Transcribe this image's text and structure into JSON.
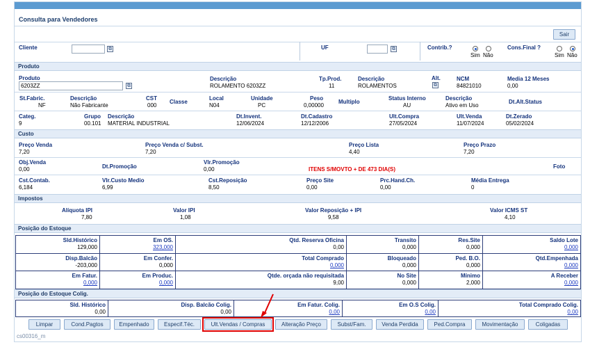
{
  "window": {
    "title": "Consulta para Vendedores",
    "footer_code": "cs00316_m"
  },
  "toolbar": {
    "exit_label": "Sair"
  },
  "header": {
    "cliente_label": "Cliente",
    "cliente_value": "",
    "uf_label": "UF",
    "uf_value": "",
    "contrib_label": "Contrib.?",
    "contrib_sim": "Sim",
    "contrib_nao": "Não",
    "contrib_selected": "Sim",
    "consfinal_label": "Cons.Final ?",
    "consfinal_sim": "Sim",
    "consfinal_nao": "Não",
    "consfinal_selected": "Não"
  },
  "produto": {
    "section": "Produto",
    "produto_label": "Produto",
    "produto_value": "6203ZZ",
    "descricao_label": "Descrição",
    "descricao_value": "ROLAMENTO 6203ZZ",
    "tpprod_label": "Tp.Prod.",
    "tpprod_value": "11",
    "descricao2_label": "Descrição",
    "descricao2_value": "ROLAMENTOS",
    "alt_label": "Alt.",
    "ncm_label": "NCM",
    "ncm_value": "84821010",
    "media12_label": "Media 12 Meses",
    "media12_value": "0,00",
    "stfabric_label": "St.Fabric.",
    "stfabric_value": "NF",
    "descricao3_label": "Descrição",
    "descricao3_value": "Não Fabricante",
    "cst_label": "CST",
    "cst_value": "000",
    "classe_label": "Classe",
    "local_label": "Local",
    "local_value": "N04",
    "unidade_label": "Unidade",
    "unidade_value": "PC",
    "peso_label": "Peso",
    "peso_value": "0,00000",
    "multiplo_label": "Multiplo",
    "statusint_label": "Status Interno",
    "statusint_value": "AU",
    "descricao4_label": "Descrição",
    "descricao4_value": "Ativo em Uso",
    "dtaltstatus_label": "Dt.Alt.Status",
    "categ_label": "Categ.",
    "categ_value": "9",
    "grupo_label": "Grupo",
    "grupo_value": "00.101",
    "descricao5_label": "Descrição",
    "descricao5_value": "MATERIAL INDUSTRIAL",
    "dtinvent_label": "Dt.Invent.",
    "dtinvent_value": "12/06/2024",
    "dtcadastro_label": "Dt.Cadastro",
    "dtcadastro_value": "12/12/2006",
    "ultcompra_label": "Ult.Compra",
    "ultcompra_value": "27/05/2024",
    "ultvenda_label": "Ult.Venda",
    "ultvenda_value": "11/07/2024",
    "dtzerado_label": "Dt.Zerado",
    "dtzerado_value": "05/02/2024"
  },
  "custo": {
    "section": "Custo",
    "precovenda_label": "Preço Venda",
    "precovenda_value": "7,20",
    "precovendasubst_label": "Preço Venda c/ Subst.",
    "precovendasubst_value": "7,20",
    "precolista_label": "Preço Lista",
    "precolista_value": "4,40",
    "precoprazo_label": "Preço Prazo",
    "precoprazo_value": "7,20",
    "objvenda_label": "Obj.Venda",
    "objvenda_value": "0,00",
    "dtpromocao_label": "Dt.Promoção",
    "vlrpromocao_label": "Vlr.Promoção",
    "vlrpromocao_value": "0,00",
    "alert": "ITENS S/MOVTO + DE 473 DIA(S)",
    "foto_label": "Foto",
    "cstcontab_label": "Cst.Contab.",
    "cstcontab_value": "6,184",
    "vlrcustomedio_label": "Vlr.Custo Medio",
    "vlrcustomedio_value": "6,99",
    "cstreposicao_label": "Cst.Reposição",
    "cstreposicao_value": "8,50",
    "precosite_label": "Preço Site",
    "precosite_value": "0,00",
    "prchandch_label": "Prc.Hand.Ch.",
    "prchandch_value": "0,00",
    "mediaentrega_label": "Média Entrega",
    "mediaentrega_value": "0"
  },
  "impostos": {
    "section": "Impostos",
    "aliquotaipi_label": "Alíquota IPI",
    "aliquotaipi_value": "7,80",
    "valoripi_label": "Valor IPI",
    "valoripi_value": "1,08",
    "valorreposicao_label": "Valor Reposição + IPI",
    "valorreposicao_value": "9,58",
    "valoricmsst_label": "Valor ICMS ST",
    "valoricmsst_value": "4,10"
  },
  "estoque": {
    "section": "Posição do Estoque",
    "rows": [
      [
        {
          "label": "Sld.Histórico",
          "value": "129,000",
          "link": false
        },
        {
          "label": "Em OS.",
          "value": "323,000",
          "link": true
        },
        {
          "label": "Qtd. Reserva Oficina",
          "value": "0,00",
          "link": false
        },
        {
          "label": "Transito",
          "value": "0,000",
          "link": false
        },
        {
          "label": "Res.Site",
          "value": "0,000",
          "link": false
        },
        {
          "label": "Saldo Lote",
          "value": "0,000",
          "link": true
        }
      ],
      [
        {
          "label": "Disp.Balcão",
          "value": "-203,000",
          "link": false
        },
        {
          "label": "Em Confer.",
          "value": "0,000",
          "link": false
        },
        {
          "label": "Total Comprado",
          "value": "0,000",
          "link": true
        },
        {
          "label": "Bloqueado",
          "value": "0,000",
          "link": false
        },
        {
          "label": "Ped. B.O.",
          "value": "0,000",
          "link": false
        },
        {
          "label": "Qtd.Empenhada",
          "value": "0,000",
          "link": true
        }
      ],
      [
        {
          "label": "Em Fatur.",
          "value": "0,000",
          "link": true
        },
        {
          "label": "Em Produc.",
          "value": "0,000",
          "link": true
        },
        {
          "label": "Qtde. orçada não requisitada",
          "value": "9,00",
          "link": false
        },
        {
          "label": "No Site",
          "value": "0,000",
          "link": false
        },
        {
          "label": "Mínimo",
          "value": "2,000",
          "link": false
        },
        {
          "label": "A Receber",
          "value": "0,000",
          "link": true
        }
      ]
    ]
  },
  "coligadas": {
    "section": "Posição do Estoque Colig.",
    "cells": [
      {
        "label": "Sld. Histórico",
        "value": "0,00",
        "link": false
      },
      {
        "label": "Disp. Balcão Colig.",
        "value": "0,00",
        "link": false
      },
      {
        "label": "Em Fatur. Colig.",
        "value": "0,00",
        "link": true
      },
      {
        "label": "Em O.S Colig.",
        "value": "0,00",
        "link": true
      },
      {
        "label": "Total Comprado Colig.",
        "value": "0,00",
        "link": true
      }
    ]
  },
  "actions": [
    "Limpar",
    "Cond.Pagtos",
    "Empenhado",
    "Especif.Téc.",
    "Ult.Vendas / Compras",
    "Alteração Preço",
    "Subst/Fam.",
    "Venda Perdida",
    "Ped.Compra",
    "Movimentação",
    "Coligadas"
  ],
  "colors": {
    "accent": "#5c9bd1",
    "label": "#13327c",
    "alert": "#e00000",
    "highlight": "#e00000"
  }
}
